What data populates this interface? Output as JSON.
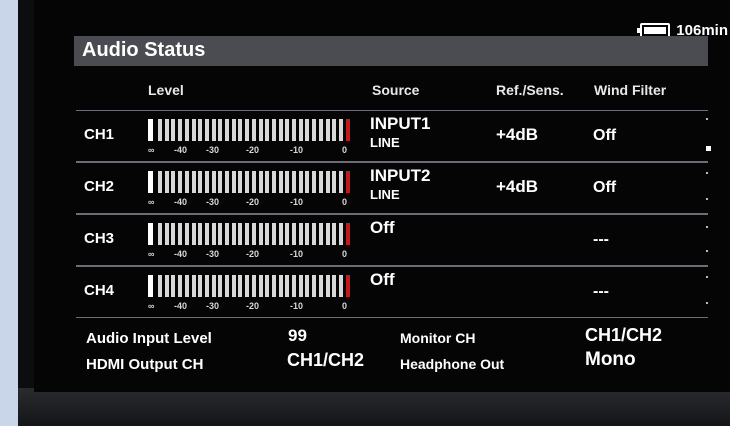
{
  "battery": {
    "value": "106",
    "unit": "min"
  },
  "title": "Audio Status",
  "columns": {
    "level": "Level",
    "source": "Source",
    "ref": "Ref./Sens.",
    "wind": "Wind Filter"
  },
  "meter_scale": [
    "∞",
    "-40",
    "-30",
    "-20",
    "-10",
    "0"
  ],
  "channels": [
    {
      "label": "CH1",
      "source": "INPUT1",
      "type": "LINE",
      "ref": "+4dB",
      "wind": "Off"
    },
    {
      "label": "CH2",
      "source": "INPUT2",
      "type": "LINE",
      "ref": "+4dB",
      "wind": "Off"
    },
    {
      "label": "CH3",
      "source": "Off",
      "type": "",
      "ref": "",
      "wind": "---"
    },
    {
      "label": "CH4",
      "source": "Off",
      "type": "",
      "ref": "",
      "wind": "---"
    }
  ],
  "footer": {
    "audio_input_level_label": "Audio Input Level",
    "audio_input_level_value": "99",
    "monitor_ch_label": "Monitor CH",
    "monitor_ch_value": "CH1/CH2",
    "hdmi_output_label": "HDMI Output CH",
    "hdmi_output_value": "CH1/CH2",
    "headphone_label": "Headphone Out",
    "headphone_value": "Mono"
  },
  "colors": {
    "header_bg": "#4a4c51",
    "peak": "#c21a1a",
    "screen_bg": "#050506"
  }
}
